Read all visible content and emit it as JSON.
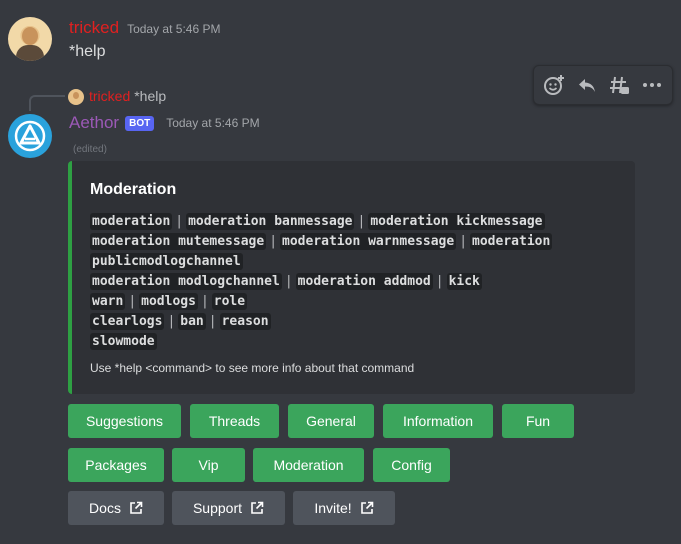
{
  "message1": {
    "author": "tricked",
    "timestamp": "Today at 5:46 PM",
    "text": "*help"
  },
  "toolbar": {
    "icons": [
      "add-reaction-icon",
      "reply-icon",
      "create-thread-icon",
      "more-icon"
    ]
  },
  "reply_preview": {
    "author": "tricked",
    "text": "*help"
  },
  "message2": {
    "author": "Aethor",
    "tag": "BOT",
    "timestamp": "Today at 5:46 PM",
    "edited": "(edited)",
    "embed": {
      "accent_color": "#2ea043",
      "title": "Moderation",
      "lines": [
        [
          "moderation",
          "moderation banmessage",
          "moderation kickmessage"
        ],
        [
          "moderation mutemessage",
          "moderation warnmessage",
          "moderation"
        ],
        [
          "publicmodlogchannel"
        ],
        [
          "moderation modlogchannel",
          "moderation addmod",
          "kick"
        ],
        [
          "warn",
          "modlogs",
          "role"
        ],
        [
          "clearlogs",
          "ban",
          "reason"
        ],
        [
          "slowmode"
        ]
      ],
      "footer": "Use *help <command> to see more info about that command"
    }
  },
  "buttons": {
    "row1": [
      "Suggestions",
      "Threads",
      "General",
      "Information",
      "Fun"
    ],
    "row2": [
      "Packages",
      "Vip",
      "Moderation",
      "Config"
    ],
    "row3": [
      "Docs",
      "Support",
      "Invite!"
    ]
  },
  "colors": {
    "background": "#36393f",
    "username_tricked": "#e02020",
    "username_bot": "#9b59b6",
    "bot_tag": "#5865f2",
    "button_green": "#3ba55c",
    "button_grey": "#4f545c"
  }
}
